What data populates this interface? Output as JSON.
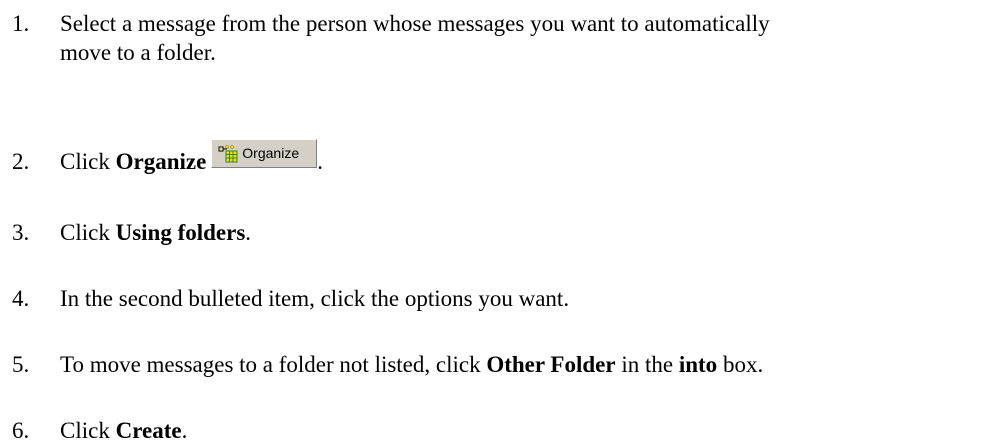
{
  "steps": [
    {
      "number": "1.",
      "line1": "Select a message from the person whose messages you want to automatically",
      "line2": "move to a folder."
    },
    {
      "number": "2.",
      "prefix": "Click ",
      "bold": "Organize",
      "button_label": "Organize",
      "button_icon": "organize-icon",
      "suffix": "."
    },
    {
      "number": "3.",
      "prefix": "Click ",
      "bold": "Using folders",
      "suffix": "."
    },
    {
      "number": "4.",
      "text": "In the second bulleted item, click the options you want."
    },
    {
      "number": "5.",
      "prefix": "To move messages to a folder not listed, click ",
      "bold1": "Other Folder",
      "middle": " in the ",
      "bold2": "into",
      "suffix": " box."
    },
    {
      "number": "6.",
      "prefix": "Click ",
      "bold": "Create",
      "suffix": "."
    }
  ],
  "colors": {
    "text": "#000000",
    "background": "#ffffff",
    "button_face": "#d4d0c8",
    "icon_yellow": "#ffd800",
    "icon_green": "#2a8a2a"
  }
}
